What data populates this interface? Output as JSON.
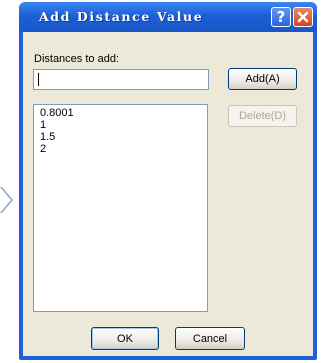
{
  "dialog": {
    "title": "Add Distance Value",
    "distances_label": "Distances to add:",
    "input_value": "",
    "add_label": "Add(A)",
    "delete_label": "Delete(D)",
    "ok_label": "OK",
    "cancel_label": "Cancel",
    "values": [
      "0.8001",
      "1",
      "1.5",
      "2"
    ]
  },
  "icons": {
    "help": "help-icon",
    "close": "close-icon",
    "side_arrow": "chevron-right-icon"
  }
}
